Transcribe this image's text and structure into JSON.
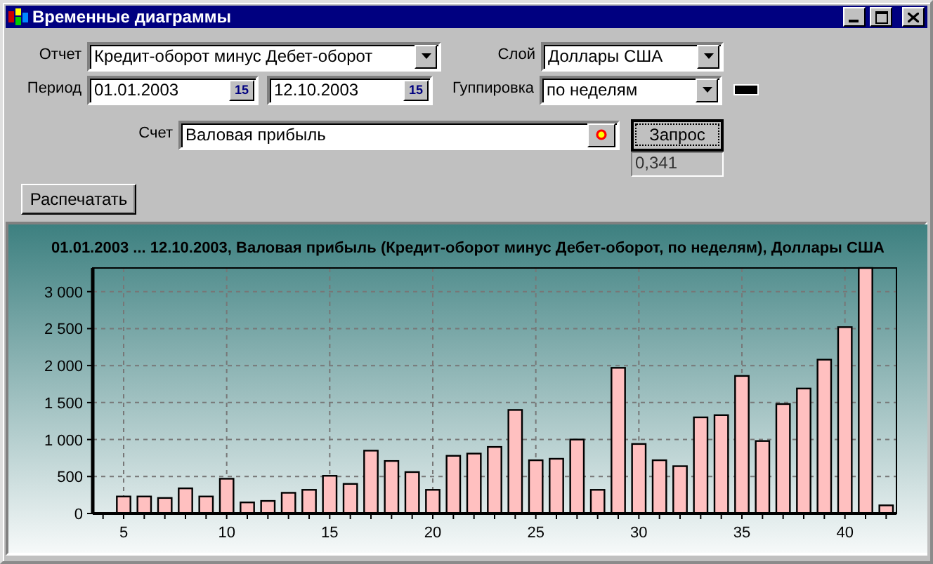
{
  "window": {
    "title": "Временные диаграммы"
  },
  "form": {
    "report": {
      "label": "Отчет",
      "value": "Кредит-оборот минус Дебет-оборот"
    },
    "layer": {
      "label": "Слой",
      "value": "Доллары США"
    },
    "period": {
      "label": "Период",
      "from": "01.01.2003",
      "from_calendar_button": "15",
      "to": "12.10.2003",
      "to_calendar_button": "15"
    },
    "grouping": {
      "label": "Гуппировка",
      "value": "по неделям"
    },
    "account": {
      "label": "Счет",
      "value": "Валовая прибыль"
    },
    "query_button": "Запрос",
    "result": "0,341",
    "print_button": "Распечатать"
  },
  "chart": {
    "chart_data": {
      "type": "bar",
      "title": "01.01.2003 ... 12.10.2003, Валовая прибыль (Кредит-оборот минус Дебет-оборот, по неделям), Доллары США",
      "x": [
        5,
        6,
        7,
        8,
        9,
        10,
        11,
        12,
        13,
        14,
        15,
        16,
        17,
        18,
        19,
        20,
        21,
        22,
        23,
        24,
        25,
        26,
        27,
        28,
        29,
        30,
        31,
        32,
        33,
        34,
        35,
        36,
        37,
        38,
        39,
        40,
        41,
        42
      ],
      "values": [
        230,
        230,
        210,
        340,
        230,
        470,
        150,
        170,
        280,
        320,
        510,
        400,
        850,
        710,
        560,
        320,
        780,
        810,
        900,
        1400,
        720,
        740,
        1000,
        320,
        1970,
        940,
        720,
        640,
        1300,
        1330,
        1860,
        980,
        1480,
        1690,
        2080,
        2520,
        3320,
        110
      ],
      "grid": true,
      "xlim": [
        3.5,
        42.5
      ],
      "ylim": [
        0,
        3320
      ],
      "xticks": [
        5,
        10,
        15,
        20,
        25,
        30,
        35,
        40
      ],
      "yticks": [
        {
          "value": 0,
          "label": "0"
        },
        {
          "value": 500,
          "label": "500"
        },
        {
          "value": 1000,
          "label": "1 000"
        },
        {
          "value": 1500,
          "label": "1 500"
        },
        {
          "value": 2000,
          "label": "2 000"
        },
        {
          "value": 2500,
          "label": "2 500"
        },
        {
          "value": 3000,
          "label": "3 000"
        }
      ]
    }
  }
}
